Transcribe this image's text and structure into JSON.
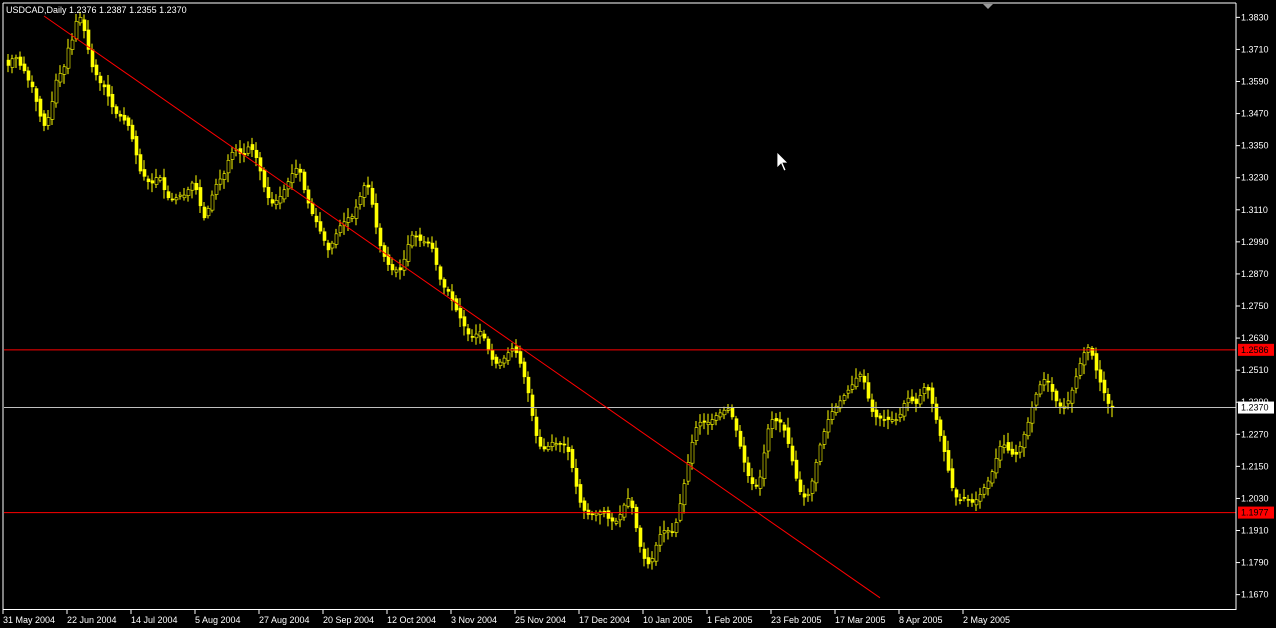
{
  "chart_data": {
    "type": "candlestick",
    "symbol_line": "USDCAD,Daily  1.2376 1.2387 1.2355 1.2370",
    "ylim": [
      1.162,
      1.388
    ],
    "y_ticks": [
      "1.3830",
      "1.3710",
      "1.3590",
      "1.3470",
      "1.3350",
      "1.3230",
      "1.3110",
      "1.2990",
      "1.2870",
      "1.2750",
      "1.2630",
      "1.2510",
      "1.2390",
      "1.2270",
      "1.2150",
      "1.2030",
      "1.1910",
      "1.1790",
      "1.1670"
    ],
    "x_labels": [
      "31 May 2004",
      "22 Jun 2004",
      "14 Jul 2004",
      "5 Aug 2004",
      "27 Aug 2004",
      "20 Sep 2004",
      "12 Oct 2004",
      "3 Nov 2004",
      "25 Nov 2004",
      "17 Dec 2004",
      "10 Jan 2005",
      "1 Feb 2005",
      "23 Feb 2005",
      "17 Mar 2005",
      "8 Apr 2005",
      "2 May 2005"
    ],
    "bars_count": 245,
    "closes": [
      1.365,
      1.3675,
      1.368,
      1.365,
      1.363,
      1.3595,
      1.357,
      1.3515,
      1.346,
      1.3425,
      1.3455,
      1.3515,
      1.3595,
      1.362,
      1.3645,
      1.3715,
      1.3745,
      1.3815,
      1.383,
      1.378,
      1.371,
      1.3645,
      1.3615,
      1.3585,
      1.357,
      1.3535,
      1.3495,
      1.347,
      1.346,
      1.3445,
      1.3425,
      1.3375,
      1.3315,
      1.3255,
      1.3235,
      1.3215,
      1.321,
      1.323,
      1.323,
      1.3185,
      1.3155,
      1.315,
      1.3155,
      1.3165,
      1.3165,
      1.3185,
      1.321,
      1.3185,
      1.3125,
      1.308,
      1.3115,
      1.3165,
      1.3205,
      1.3225,
      1.3245,
      1.3295,
      1.3325,
      1.3335,
      1.332,
      1.3315,
      1.3345,
      1.3335,
      1.3305,
      1.3255,
      1.3195,
      1.3155,
      1.3135,
      1.3145,
      1.316,
      1.3185,
      1.3215,
      1.3245,
      1.3265,
      1.325,
      1.3185,
      1.3135,
      1.3095,
      1.3065,
      1.303,
      1.2995,
      1.296,
      1.2985,
      1.302,
      1.305,
      1.3065,
      1.308,
      1.3085,
      1.312,
      1.316,
      1.32,
      1.3195,
      1.313,
      1.3045,
      1.2975,
      1.2935,
      1.2905,
      1.2885,
      1.2885,
      1.2885,
      1.2925,
      1.298,
      1.3015,
      1.301,
      1.2995,
      1.299,
      1.2985,
      1.2965,
      1.2905,
      1.285,
      1.282,
      1.2805,
      1.277,
      1.2735,
      1.2705,
      1.2675,
      1.2645,
      1.2635,
      1.2645,
      1.2655,
      1.263,
      1.2585,
      1.255,
      1.2535,
      1.254,
      1.2555,
      1.2575,
      1.259,
      1.2575,
      1.2535,
      1.2485,
      1.2425,
      1.234,
      1.2265,
      1.2225,
      1.2215,
      1.2225,
      1.224,
      1.2235,
      1.2235,
      1.223,
      1.2205,
      1.2145,
      1.2075,
      1.2015,
      1.1985,
      1.197,
      1.197,
      1.1975,
      1.198,
      1.1975,
      1.1955,
      1.1945,
      1.1945,
      1.197,
      1.2005,
      1.203,
      1.1995,
      1.192,
      1.185,
      1.1805,
      1.1785,
      1.1805,
      1.1855,
      1.1895,
      1.191,
      1.191,
      1.1905,
      1.194,
      1.201,
      1.2085,
      1.2165,
      1.224,
      1.2295,
      1.2315,
      1.2315,
      1.2315,
      1.2325,
      1.234,
      1.235,
      1.236,
      1.2365,
      1.2335,
      1.2285,
      1.2225,
      1.2165,
      1.2115,
      1.2085,
      1.2075,
      1.211,
      1.22,
      1.229,
      1.2325,
      1.232,
      1.2315,
      1.2285,
      1.2235,
      1.217,
      1.2105,
      1.2055,
      1.2035,
      1.2045,
      1.2095,
      1.2165,
      1.223,
      1.228,
      1.2325,
      1.2355,
      1.2375,
      1.2395,
      1.2415,
      1.2435,
      1.2455,
      1.248,
      1.2495,
      1.2465,
      1.2405,
      1.2355,
      1.2335,
      1.233,
      1.2325,
      1.2325,
      1.2325,
      1.2325,
      1.2345,
      1.2385,
      1.2405,
      1.2395,
      1.2385,
      1.2415,
      1.2445,
      1.2435,
      1.2385,
      1.2325,
      1.2265,
      1.2205,
      1.2135,
      1.207,
      1.2035,
      1.2025,
      1.203,
      1.2025,
      1.2015,
      1.2025,
      1.2045,
      1.207,
      1.2095,
      1.213,
      1.218,
      1.2225,
      1.223,
      1.221,
      1.2195,
      1.2195,
      1.2225,
      1.227,
      1.2315,
      1.237,
      1.242,
      1.2455,
      1.2475,
      1.2465,
      1.243,
      1.2395,
      1.2375,
      1.2375,
      1.2395,
      1.2435,
      1.2485,
      1.2535,
      1.2575,
      1.2595,
      1.2565,
      1.251,
      1.2465,
      1.2425,
      1.2385,
      1.237
    ],
    "current_price": {
      "label": "1.2370",
      "value": 1.237,
      "color": "#c0c0c0"
    },
    "resistance": {
      "label": "1.2586",
      "value": 1.2586,
      "color": "#ff0000"
    },
    "support": {
      "label": "1.1977",
      "value": 1.1977,
      "color": "#ff0000"
    },
    "trendline": {
      "from_bar": 44,
      "from_price": 1.3835,
      "to_bar": 880,
      "to_price": 1.1658,
      "color": "#ff0000"
    },
    "colors": {
      "background": "#000000",
      "candle": "#ffff00",
      "axis": "#ffffff",
      "text": "#ffffff"
    },
    "grid": false,
    "cursor_icon": "arrow-cursor-icon",
    "scroll_marker_icon": "chart-shift-triangle-icon"
  }
}
